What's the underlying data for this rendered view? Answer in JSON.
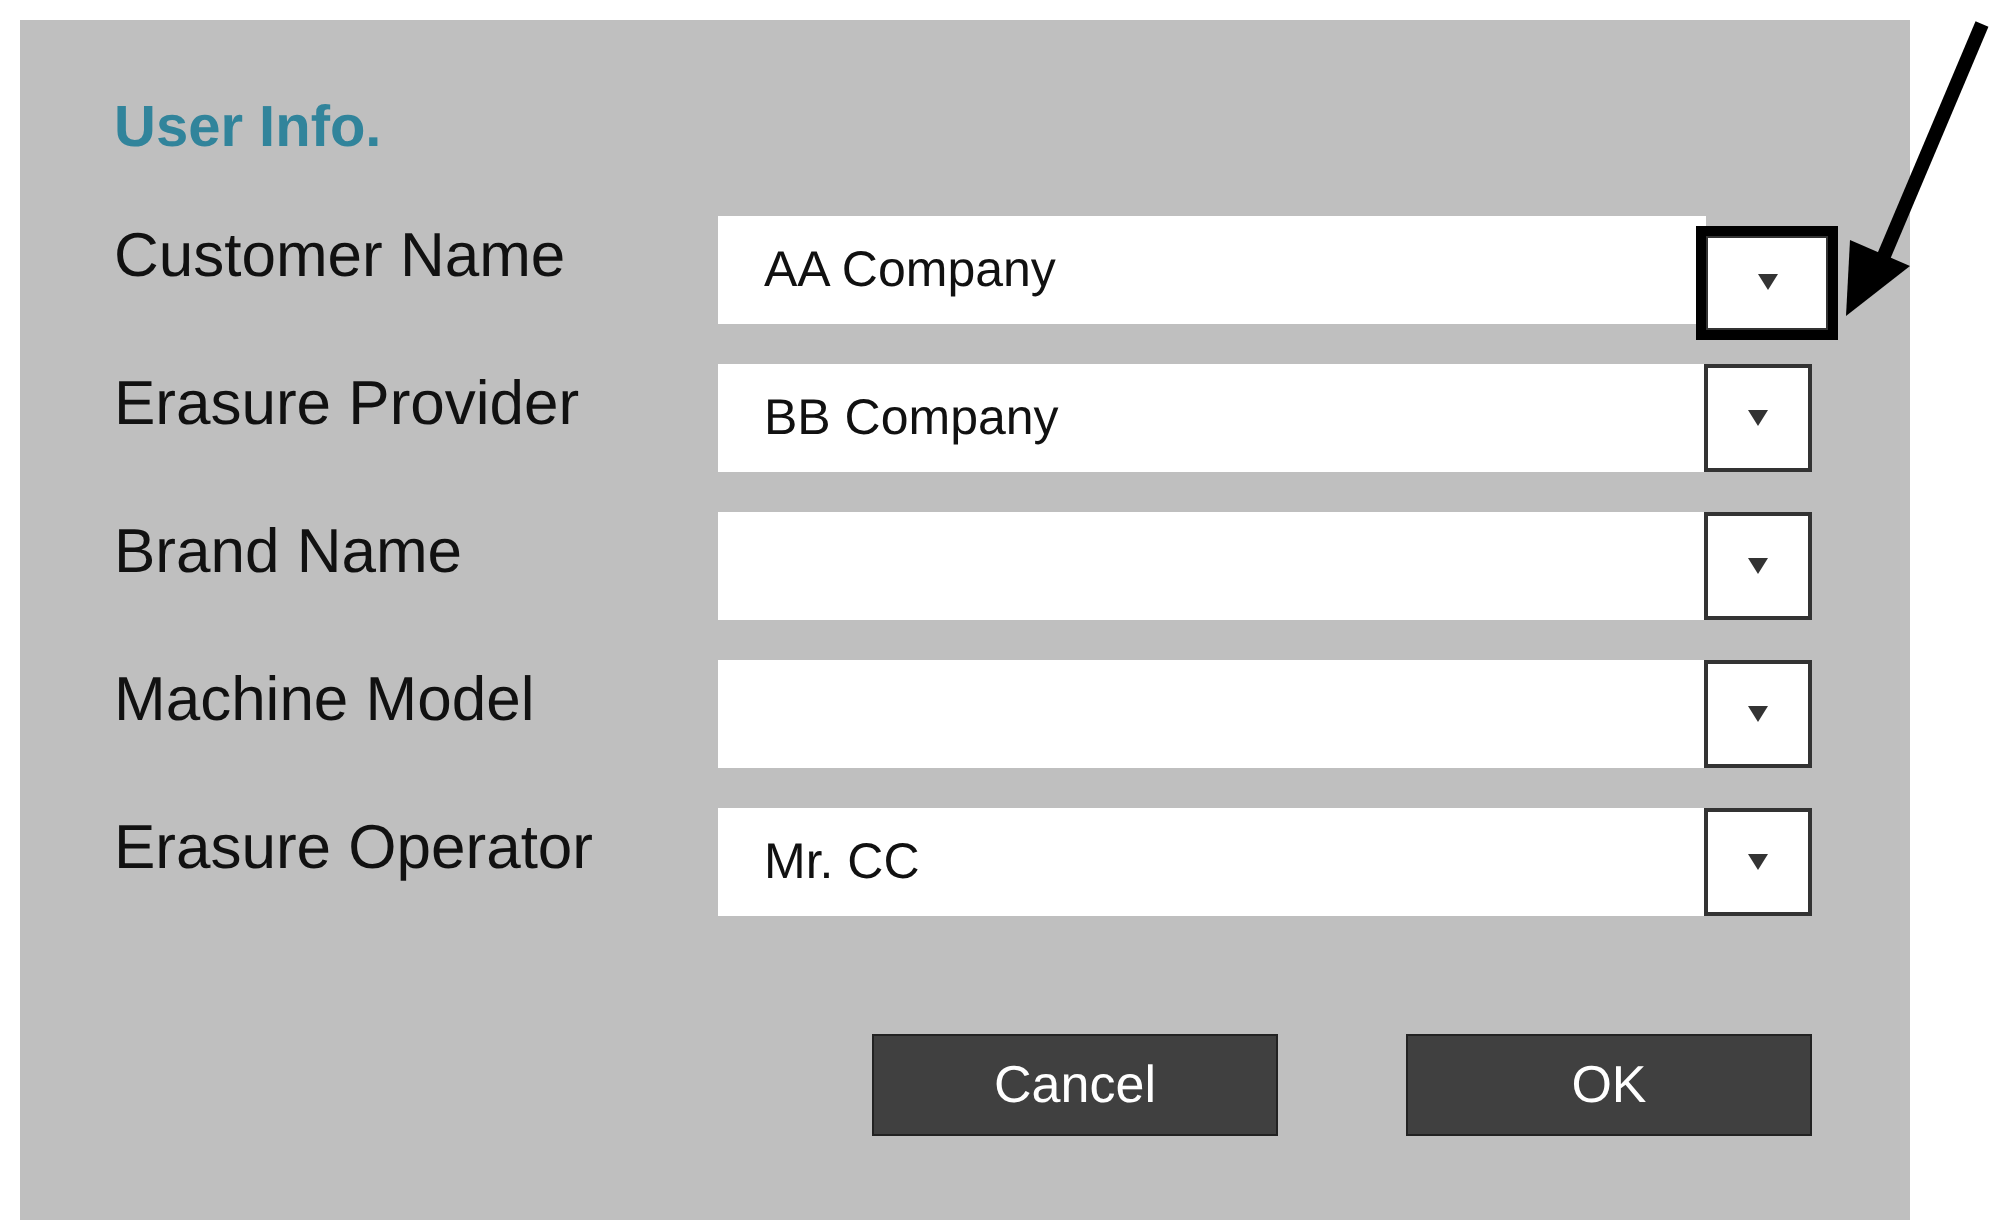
{
  "dialog": {
    "title": "User Info.",
    "fields": [
      {
        "label": "Customer Name",
        "value": "AA Company",
        "highlighted": true
      },
      {
        "label": "Erasure Provider",
        "value": "BB Company",
        "highlighted": false
      },
      {
        "label": "Brand Name",
        "highlighted": false
      },
      {
        "label": "Machine Model",
        "highlighted": false
      },
      {
        "label": "Erasure Operator",
        "value": "Mr. CC",
        "highlighted": false
      }
    ],
    "buttons": [
      "Cancel",
      "OK"
    ]
  },
  "annotation": {
    "kind": "arrow"
  }
}
